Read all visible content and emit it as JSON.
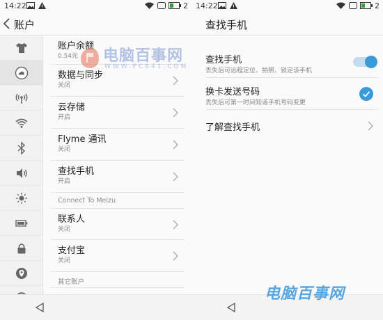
{
  "status": {
    "time": "14:22",
    "battery_level": "2"
  },
  "left": {
    "title": "账户",
    "rail_icons": [
      "shirt-icon",
      "cloud-icon",
      "hotspot-icon",
      "wifi-icon",
      "bluetooth-icon",
      "volume-icon",
      "brightness-icon",
      "battery-icon",
      "lock-icon",
      "location-icon",
      "globe-icon"
    ],
    "items": [
      {
        "label": "账户余额",
        "sub": "0.54元"
      },
      {
        "label": "数据与同步",
        "sub": "关闭"
      },
      {
        "label": "云存储",
        "sub": "开启"
      },
      {
        "label": "Flyme 通讯",
        "sub": "关闭"
      },
      {
        "label": "查找手机",
        "sub": "开启"
      }
    ],
    "section_connect": "Connect To Meizu",
    "connect_items": [
      {
        "label": "联系人",
        "sub": "关闭"
      },
      {
        "label": "支付宝",
        "sub": "关闭"
      }
    ],
    "section_other": "其它账户"
  },
  "right": {
    "title": "查找手机",
    "find_phone": {
      "label": "查找手机",
      "sub": "丢失后可远程定位、拍照、锁定该手机",
      "enabled": true
    },
    "sim_change": {
      "label": "换卡发送号码",
      "sub": "丢失后可第一时间知道手机号码变更",
      "checked": true
    },
    "learn_more": {
      "label": "了解查找手机"
    }
  },
  "watermark": {
    "brand": "电脑百事网",
    "url": "WWW.PC841.COM",
    "bottom": "电脑百事网"
  },
  "colors": {
    "accent": "#3a9bdc",
    "toggle_track": "#c7dbef"
  }
}
